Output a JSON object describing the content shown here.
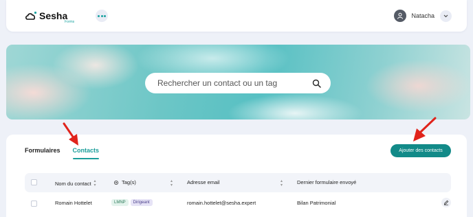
{
  "header": {
    "logo_text": "Sesha",
    "logo_sub": "Forms",
    "user_name": "Natacha"
  },
  "search": {
    "placeholder": "Rechercher un contact ou un tag"
  },
  "tabs": [
    {
      "label": "Formulaires",
      "active": false
    },
    {
      "label": "Contacts",
      "active": true
    }
  ],
  "actions": {
    "add_contacts_label": "Ajouter des contacts"
  },
  "table": {
    "columns": [
      "Nom du contact",
      "Tag(s)",
      "Adresse email",
      "Dernier formulaire envoyé"
    ],
    "rows": [
      {
        "name": "Romain Hottelet",
        "tags": [
          "LMNP",
          "Dirigeant"
        ],
        "email": "romain.hottelet@sesha.expert",
        "last_form": "Bilan Patrimonial"
      }
    ]
  },
  "colors": {
    "accent": "#128a88",
    "tab_active": "#1a9d9a",
    "annotation_arrow": "#e0231b"
  },
  "icons": {
    "logo": "cloud-logo-icon",
    "menu": "dots-icon",
    "avatar": "user-icon",
    "user_menu": "chevron-down-icon",
    "search": "search-icon",
    "tags_header": "gear-icon",
    "edit": "pencil-icon"
  }
}
